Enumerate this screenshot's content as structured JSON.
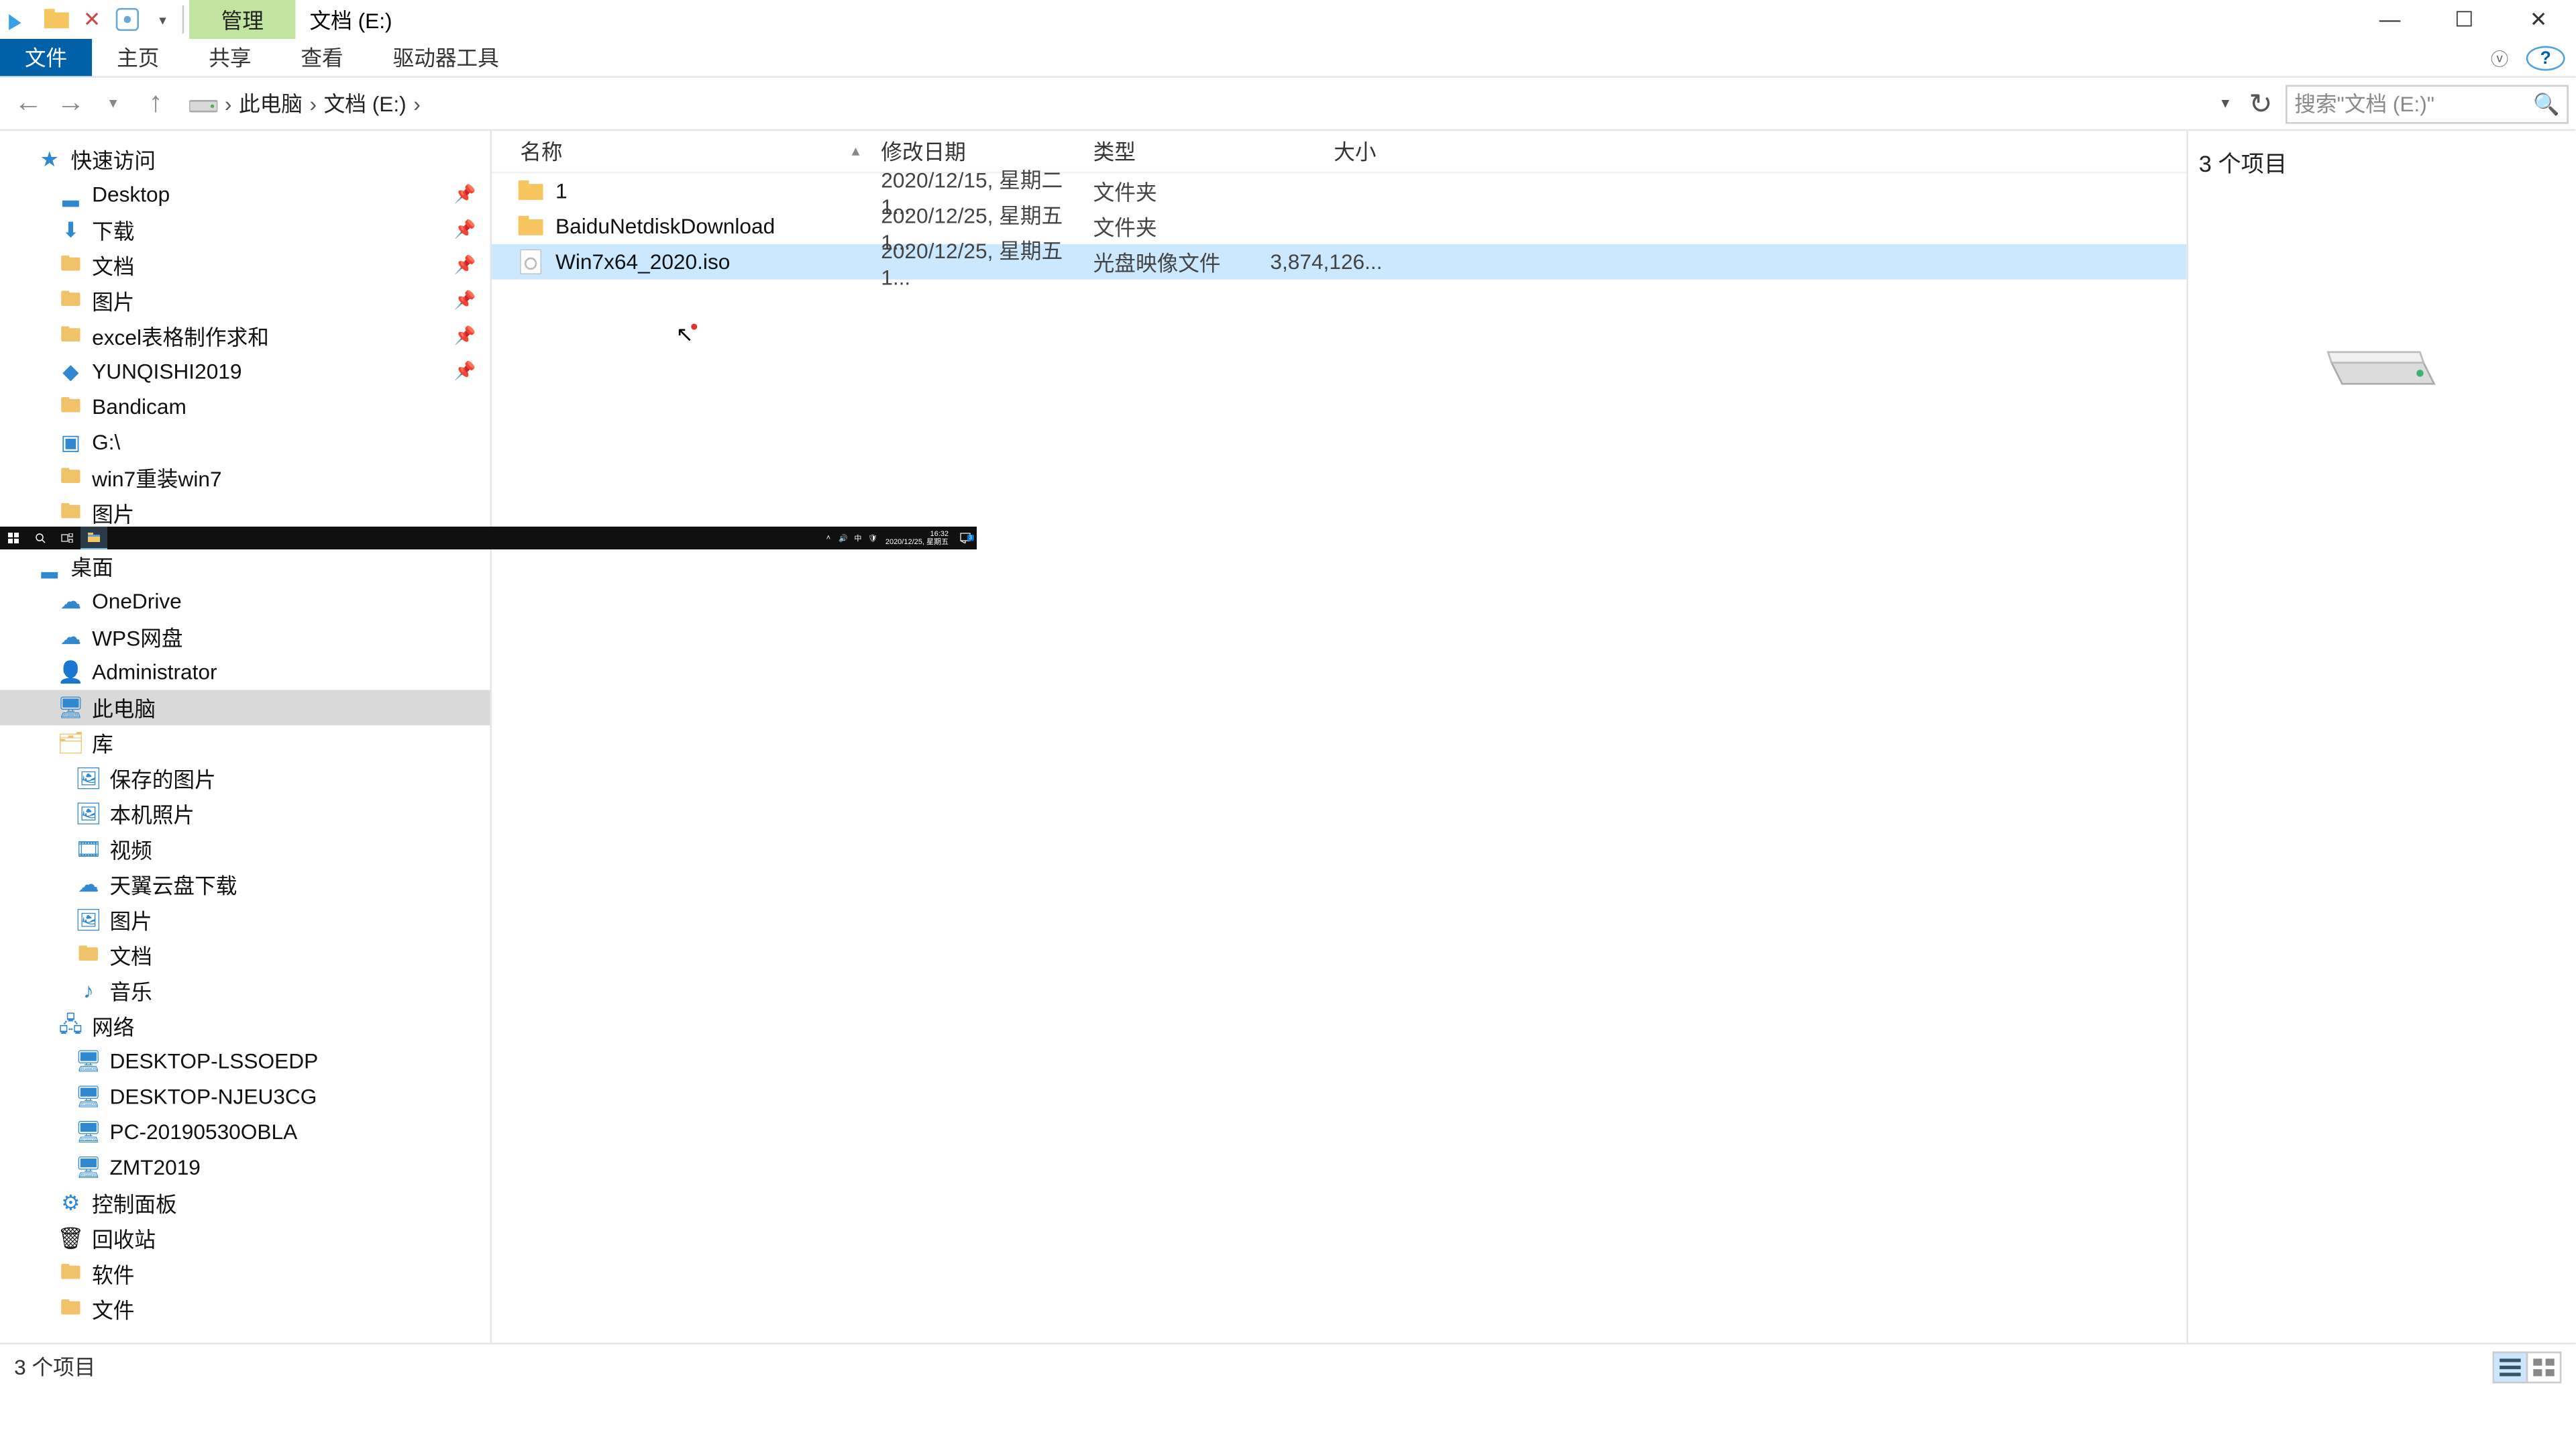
{
  "titlebar": {
    "qat_icons": [
      "app-icon",
      "folder-icon",
      "close-icon",
      "properties-icon"
    ],
    "context_tab": "管理",
    "location_label": "文档 (E:)"
  },
  "window_controls": {
    "minimize": "—",
    "maximize": "☐",
    "close": "✕"
  },
  "ribbon": {
    "file": "文件",
    "home": "主页",
    "share": "共享",
    "view": "查看",
    "drive_tools": "驱动器工具"
  },
  "breadcrumb": {
    "root": "此电脑",
    "current": "文档 (E:)",
    "arrow": "›"
  },
  "search": {
    "placeholder": "搜索\"文档 (E:)\""
  },
  "nav": {
    "quick_access": "快速访问",
    "desktop": "Desktop",
    "downloads": "下载",
    "documents": "文档",
    "pictures": "图片",
    "excel": "excel表格制作求和",
    "yunqishi": "YUNQISHI2019",
    "bandicam": "Bandicam",
    "gdrive": "G:\\",
    "win7reinstall": "win7重装win7",
    "pictures2": "图片",
    "desktop_cn": "桌面",
    "onedrive": "OneDrive",
    "wps": "WPS网盘",
    "admin": "Administrator",
    "thispc": "此电脑",
    "libraries": "库",
    "saved_pictures": "保存的图片",
    "camera_roll": "本机照片",
    "videos": "视频",
    "tianyi": "天翼云盘下载",
    "lib_pictures": "图片",
    "lib_documents": "文档",
    "music": "音乐",
    "network": "网络",
    "pc1": "DESKTOP-LSSOEDP",
    "pc2": "DESKTOP-NJEU3CG",
    "pc3": "PC-20190530OBLA",
    "pc4": "ZMT2019",
    "control_panel": "控制面板",
    "recycle": "回收站",
    "software": "软件",
    "files": "文件"
  },
  "columns": {
    "name": "名称",
    "date": "修改日期",
    "type": "类型",
    "size": "大小"
  },
  "rows": [
    {
      "name": "1",
      "date": "2020/12/15, 星期二 1...",
      "type": "文件夹",
      "size": "",
      "icon": "folder",
      "selected": false
    },
    {
      "name": "BaiduNetdiskDownload",
      "date": "2020/12/25, 星期五 1...",
      "type": "文件夹",
      "size": "",
      "icon": "folder",
      "selected": false
    },
    {
      "name": "Win7x64_2020.iso",
      "date": "2020/12/25, 星期五 1...",
      "type": "光盘映像文件",
      "size": "3,874,126...",
      "icon": "iso",
      "selected": true
    }
  ],
  "preview": {
    "count_label": "3 个项目"
  },
  "status": {
    "text": "3 个项目"
  },
  "taskbar": {
    "time": "16:32",
    "date": "2020/12/25, 星期五",
    "ime": "中",
    "notification_badge": "3"
  }
}
